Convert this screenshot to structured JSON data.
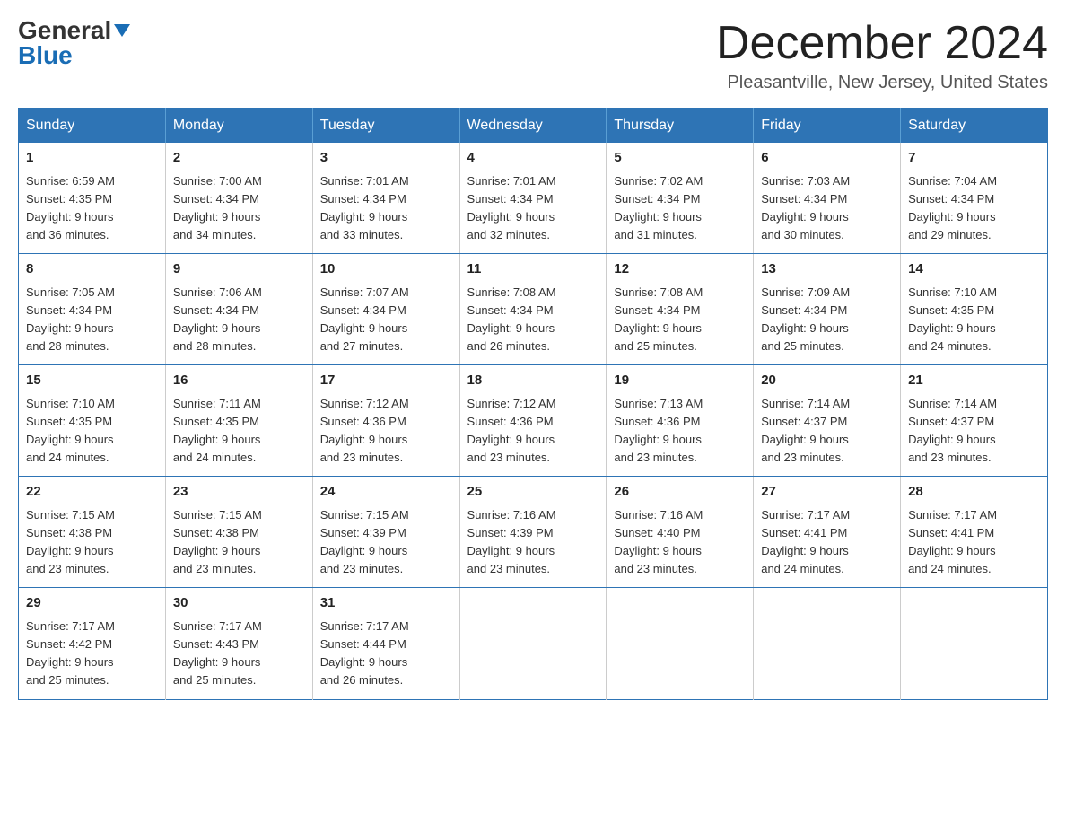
{
  "header": {
    "logo_general": "General",
    "logo_blue": "Blue",
    "month_title": "December 2024",
    "location": "Pleasantville, New Jersey, United States"
  },
  "days_of_week": [
    "Sunday",
    "Monday",
    "Tuesday",
    "Wednesday",
    "Thursday",
    "Friday",
    "Saturday"
  ],
  "weeks": [
    [
      {
        "day": "1",
        "sunrise": "6:59 AM",
        "sunset": "4:35 PM",
        "daylight": "9 hours and 36 minutes."
      },
      {
        "day": "2",
        "sunrise": "7:00 AM",
        "sunset": "4:34 PM",
        "daylight": "9 hours and 34 minutes."
      },
      {
        "day": "3",
        "sunrise": "7:01 AM",
        "sunset": "4:34 PM",
        "daylight": "9 hours and 33 minutes."
      },
      {
        "day": "4",
        "sunrise": "7:01 AM",
        "sunset": "4:34 PM",
        "daylight": "9 hours and 32 minutes."
      },
      {
        "day": "5",
        "sunrise": "7:02 AM",
        "sunset": "4:34 PM",
        "daylight": "9 hours and 31 minutes."
      },
      {
        "day": "6",
        "sunrise": "7:03 AM",
        "sunset": "4:34 PM",
        "daylight": "9 hours and 30 minutes."
      },
      {
        "day": "7",
        "sunrise": "7:04 AM",
        "sunset": "4:34 PM",
        "daylight": "9 hours and 29 minutes."
      }
    ],
    [
      {
        "day": "8",
        "sunrise": "7:05 AM",
        "sunset": "4:34 PM",
        "daylight": "9 hours and 28 minutes."
      },
      {
        "day": "9",
        "sunrise": "7:06 AM",
        "sunset": "4:34 PM",
        "daylight": "9 hours and 28 minutes."
      },
      {
        "day": "10",
        "sunrise": "7:07 AM",
        "sunset": "4:34 PM",
        "daylight": "9 hours and 27 minutes."
      },
      {
        "day": "11",
        "sunrise": "7:08 AM",
        "sunset": "4:34 PM",
        "daylight": "9 hours and 26 minutes."
      },
      {
        "day": "12",
        "sunrise": "7:08 AM",
        "sunset": "4:34 PM",
        "daylight": "9 hours and 25 minutes."
      },
      {
        "day": "13",
        "sunrise": "7:09 AM",
        "sunset": "4:34 PM",
        "daylight": "9 hours and 25 minutes."
      },
      {
        "day": "14",
        "sunrise": "7:10 AM",
        "sunset": "4:35 PM",
        "daylight": "9 hours and 24 minutes."
      }
    ],
    [
      {
        "day": "15",
        "sunrise": "7:10 AM",
        "sunset": "4:35 PM",
        "daylight": "9 hours and 24 minutes."
      },
      {
        "day": "16",
        "sunrise": "7:11 AM",
        "sunset": "4:35 PM",
        "daylight": "9 hours and 24 minutes."
      },
      {
        "day": "17",
        "sunrise": "7:12 AM",
        "sunset": "4:36 PM",
        "daylight": "9 hours and 23 minutes."
      },
      {
        "day": "18",
        "sunrise": "7:12 AM",
        "sunset": "4:36 PM",
        "daylight": "9 hours and 23 minutes."
      },
      {
        "day": "19",
        "sunrise": "7:13 AM",
        "sunset": "4:36 PM",
        "daylight": "9 hours and 23 minutes."
      },
      {
        "day": "20",
        "sunrise": "7:14 AM",
        "sunset": "4:37 PM",
        "daylight": "9 hours and 23 minutes."
      },
      {
        "day": "21",
        "sunrise": "7:14 AM",
        "sunset": "4:37 PM",
        "daylight": "9 hours and 23 minutes."
      }
    ],
    [
      {
        "day": "22",
        "sunrise": "7:15 AM",
        "sunset": "4:38 PM",
        "daylight": "9 hours and 23 minutes."
      },
      {
        "day": "23",
        "sunrise": "7:15 AM",
        "sunset": "4:38 PM",
        "daylight": "9 hours and 23 minutes."
      },
      {
        "day": "24",
        "sunrise": "7:15 AM",
        "sunset": "4:39 PM",
        "daylight": "9 hours and 23 minutes."
      },
      {
        "day": "25",
        "sunrise": "7:16 AM",
        "sunset": "4:39 PM",
        "daylight": "9 hours and 23 minutes."
      },
      {
        "day": "26",
        "sunrise": "7:16 AM",
        "sunset": "4:40 PM",
        "daylight": "9 hours and 23 minutes."
      },
      {
        "day": "27",
        "sunrise": "7:17 AM",
        "sunset": "4:41 PM",
        "daylight": "9 hours and 24 minutes."
      },
      {
        "day": "28",
        "sunrise": "7:17 AM",
        "sunset": "4:41 PM",
        "daylight": "9 hours and 24 minutes."
      }
    ],
    [
      {
        "day": "29",
        "sunrise": "7:17 AM",
        "sunset": "4:42 PM",
        "daylight": "9 hours and 25 minutes."
      },
      {
        "day": "30",
        "sunrise": "7:17 AM",
        "sunset": "4:43 PM",
        "daylight": "9 hours and 25 minutes."
      },
      {
        "day": "31",
        "sunrise": "7:17 AM",
        "sunset": "4:44 PM",
        "daylight": "9 hours and 26 minutes."
      },
      null,
      null,
      null,
      null
    ]
  ],
  "labels": {
    "sunrise": "Sunrise: ",
    "sunset": "Sunset: ",
    "daylight": "Daylight: "
  }
}
